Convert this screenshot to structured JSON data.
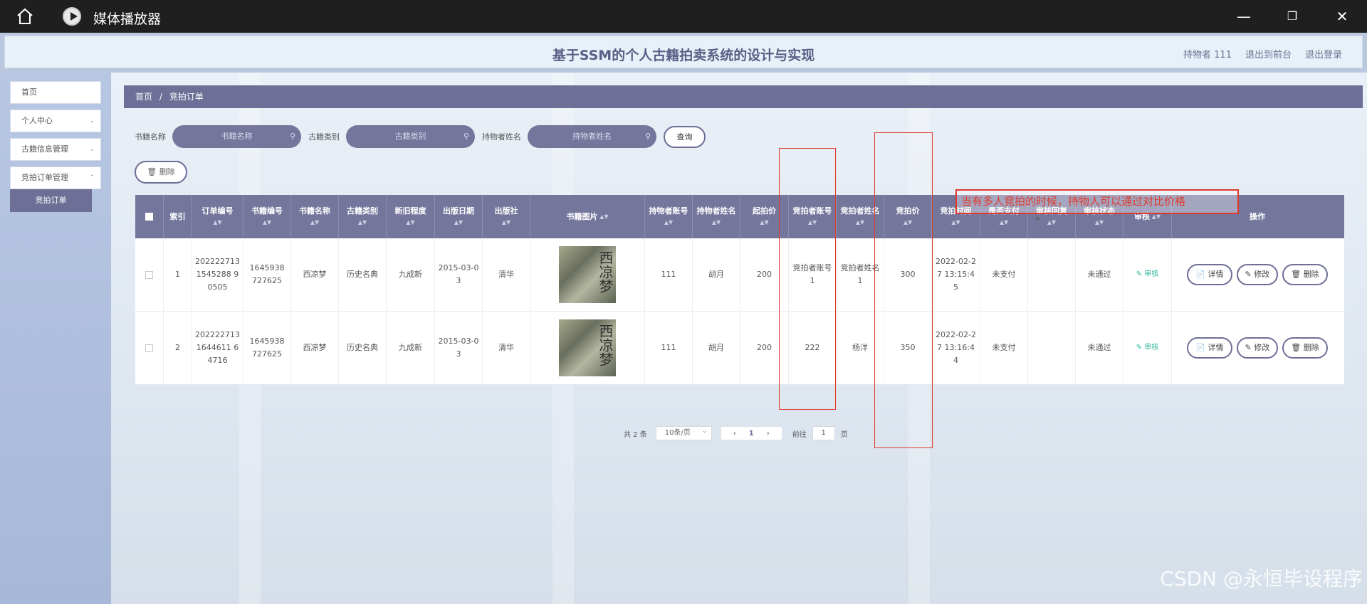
{
  "window": {
    "title": "媒体播放器"
  },
  "header": {
    "title": "基于SSM的个人古籍拍卖系统的设计与实现",
    "links": [
      "持物者 111",
      "退出到前台",
      "退出登录"
    ]
  },
  "sidebar": {
    "items": [
      "首页",
      "个人中心",
      "古籍信息管理",
      "竞拍订单管理"
    ],
    "active_sub": "竞拍订单"
  },
  "breadcrumb": {
    "home": "首页",
    "sep": "/",
    "current": "竞拍订单"
  },
  "search": {
    "fields": [
      {
        "label": "书籍名称",
        "placeholder": "书籍名称"
      },
      {
        "label": "古籍类别",
        "placeholder": "古籍类别"
      },
      {
        "label": "持物者姓名",
        "placeholder": "持物者姓名"
      }
    ],
    "query_label": "查询",
    "delete_label": "删除"
  },
  "table": {
    "headers": [
      "索引",
      "订单编号",
      "书籍编号",
      "书籍名称",
      "古籍类别",
      "新旧程度",
      "出版日期",
      "出版社",
      "书籍图片",
      "持物者账号",
      "持物者姓名",
      "起拍价",
      "竞拍者账号",
      "竞拍者姓名",
      "竞拍价",
      "竞拍时间",
      "是否支付",
      "审核回复",
      "审核状态",
      "审核",
      "操作"
    ],
    "rows": [
      [
        "1",
        "2022227131545288 90505",
        "1645938 727625",
        "西凉梦",
        "历史名典",
        "九成新",
        "2015-03-03",
        "清华",
        "",
        "111",
        "胡月",
        "200",
        "竞拍者账号1",
        "竞拍者姓名1",
        "300",
        "2022-02-27 13:15:45",
        "未支付",
        "",
        "未通过",
        "审核",
        ""
      ],
      [
        "2",
        "2022227131644611 64716",
        "1645938 727625",
        "西凉梦",
        "历史名典",
        "九成新",
        "2015-03-03",
        "清华",
        "",
        "111",
        "胡月",
        "200",
        "222",
        "杨洋",
        "350",
        "2022-02-27 13:16:44",
        "未支付",
        "",
        "未通过",
        "审核",
        ""
      ]
    ],
    "row_actions": [
      "详情",
      "修改",
      "删除"
    ],
    "cover_text": "西凉梦"
  },
  "pagination": {
    "total": "共 2 条",
    "page_size": "10条/页",
    "current_page": "1",
    "goto_prefix": "前往",
    "goto_value": "1",
    "goto_suffix": "页"
  },
  "annotation": {
    "text": "当有多人竞拍的时候，持物人可以通过对比价格"
  },
  "watermark": "CSDN @永恒毕设程序",
  "colors": {
    "accent": "#6d6f97",
    "annotation": "#e0392b",
    "audit_link": "#2bb39a"
  }
}
